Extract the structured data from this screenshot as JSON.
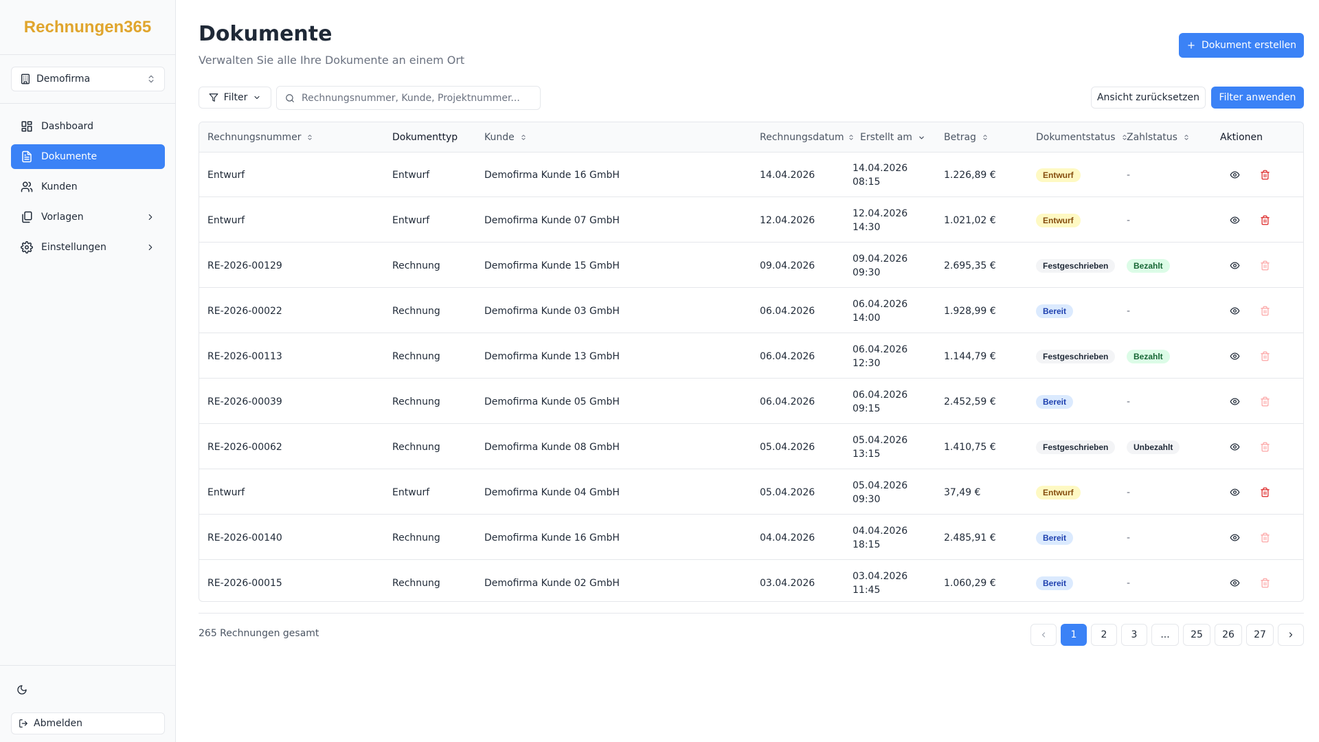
{
  "sidebar": {
    "brand": "Rechnungen365",
    "company": "Demofirma",
    "nav": [
      {
        "label": "Dashboard",
        "icon": "dashboard-icon"
      },
      {
        "label": "Dokumente",
        "icon": "document-icon"
      },
      {
        "label": "Kunden",
        "icon": "users-icon"
      },
      {
        "label": "Vorlagen",
        "icon": "templates-icon"
      },
      {
        "label": "Einstellungen",
        "icon": "gear-icon"
      }
    ],
    "logout": "Abmelden"
  },
  "page": {
    "title": "Dokumente",
    "subtitle": "Verwalten Sie alle Ihre Dokumente an einem Ort",
    "create_button": "Dokument erstellen"
  },
  "toolbar": {
    "filter": "Filter",
    "search_placeholder": "Rechnungsnummer, Kunde, Projektnummer...",
    "reset": "Ansicht zurücksetzen",
    "apply": "Filter anwenden"
  },
  "table": {
    "headers": {
      "number": "Rechnungsnummer",
      "type": "Dokumenttyp",
      "customer": "Kunde",
      "invoice_date": "Rechnungsdatum",
      "created": "Erstellt am",
      "amount": "Betrag",
      "doc_status": "Dokumentstatus",
      "pay_status": "Zahlstatus",
      "actions": "Aktionen"
    },
    "rows": [
      {
        "number": "Entwurf",
        "type": "Entwurf",
        "customer": "Demofirma Kunde 16 GmbH",
        "invoice_date": "14.04.2026",
        "created_date": "14.04.2026",
        "created_time": "08:15",
        "amount": "1.226,89 €",
        "doc_status": "Entwurf",
        "pay_status": "-"
      },
      {
        "number": "Entwurf",
        "type": "Entwurf",
        "customer": "Demofirma Kunde 07 GmbH",
        "invoice_date": "12.04.2026",
        "created_date": "12.04.2026",
        "created_time": "14:30",
        "amount": "1.021,02 €",
        "doc_status": "Entwurf",
        "pay_status": "-"
      },
      {
        "number": "RE-2026-00129",
        "type": "Rechnung",
        "customer": "Demofirma Kunde 15 GmbH",
        "invoice_date": "09.04.2026",
        "created_date": "09.04.2026",
        "created_time": "09:30",
        "amount": "2.695,35 €",
        "doc_status": "Festgeschrieben",
        "pay_status": "Bezahlt"
      },
      {
        "number": "RE-2026-00022",
        "type": "Rechnung",
        "customer": "Demofirma Kunde 03 GmbH",
        "invoice_date": "06.04.2026",
        "created_date": "06.04.2026",
        "created_time": "14:00",
        "amount": "1.928,99 €",
        "doc_status": "Bereit",
        "pay_status": "-"
      },
      {
        "number": "RE-2026-00113",
        "type": "Rechnung",
        "customer": "Demofirma Kunde 13 GmbH",
        "invoice_date": "06.04.2026",
        "created_date": "06.04.2026",
        "created_time": "12:30",
        "amount": "1.144,79 €",
        "doc_status": "Festgeschrieben",
        "pay_status": "Bezahlt"
      },
      {
        "number": "RE-2026-00039",
        "type": "Rechnung",
        "customer": "Demofirma Kunde 05 GmbH",
        "invoice_date": "06.04.2026",
        "created_date": "06.04.2026",
        "created_time": "09:15",
        "amount": "2.452,59 €",
        "doc_status": "Bereit",
        "pay_status": "-"
      },
      {
        "number": "RE-2026-00062",
        "type": "Rechnung",
        "customer": "Demofirma Kunde 08 GmbH",
        "invoice_date": "05.04.2026",
        "created_date": "05.04.2026",
        "created_time": "13:15",
        "amount": "1.410,75 €",
        "doc_status": "Festgeschrieben",
        "pay_status": "Unbezahlt"
      },
      {
        "number": "Entwurf",
        "type": "Entwurf",
        "customer": "Demofirma Kunde 04 GmbH",
        "invoice_date": "05.04.2026",
        "created_date": "05.04.2026",
        "created_time": "09:30",
        "amount": "37,49 €",
        "doc_status": "Entwurf",
        "pay_status": "-"
      },
      {
        "number": "RE-2026-00140",
        "type": "Rechnung",
        "customer": "Demofirma Kunde 16 GmbH",
        "invoice_date": "04.04.2026",
        "created_date": "04.04.2026",
        "created_time": "18:15",
        "amount": "2.485,91 €",
        "doc_status": "Bereit",
        "pay_status": "-"
      },
      {
        "number": "RE-2026-00015",
        "type": "Rechnung",
        "customer": "Demofirma Kunde 02 GmbH",
        "invoice_date": "03.04.2026",
        "created_date": "03.04.2026",
        "created_time": "11:45",
        "amount": "1.060,29 €",
        "doc_status": "Bereit",
        "pay_status": "-"
      }
    ]
  },
  "footer": {
    "total": "265 Rechnungen gesamt",
    "pages": [
      "1",
      "2",
      "3",
      "...",
      "25",
      "26",
      "27"
    ],
    "current_page": "1"
  },
  "colors": {
    "brand": "#e0a52d",
    "accent": "#3b82f6",
    "delete_enabled": "#dc2626",
    "delete_disabled": "#fca5a5"
  }
}
